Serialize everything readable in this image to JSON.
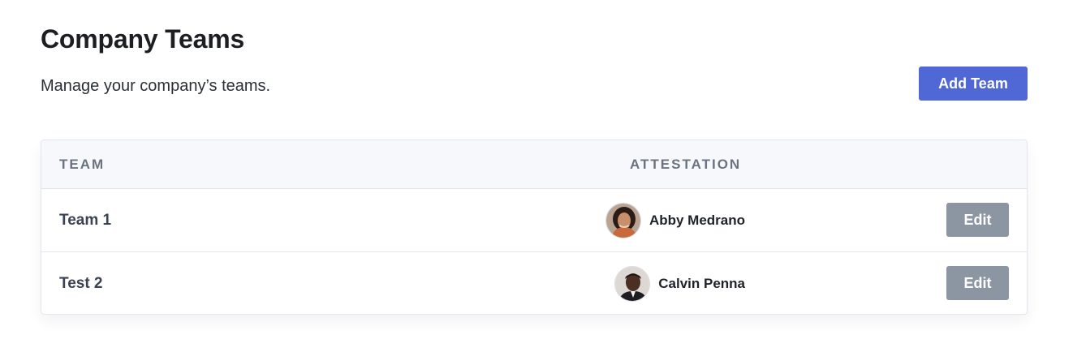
{
  "header": {
    "title": "Company Teams",
    "subtitle": "Manage your company’s teams.",
    "add_button_label": "Add Team"
  },
  "table": {
    "columns": [
      "TEAM",
      "ATTESTATION"
    ],
    "rows": [
      {
        "team": "Team 1",
        "attestation": "Abby Medrano",
        "avatar": "woman-portrait-avatar",
        "edit_label": "Edit"
      },
      {
        "team": "Test 2",
        "attestation": "Calvin Penna",
        "avatar": "man-portrait-avatar",
        "edit_label": "Edit"
      }
    ]
  },
  "colors": {
    "primary_button": "#5068d6",
    "secondary_button": "#8c96a3",
    "header_bg": "#f7f8fb"
  }
}
